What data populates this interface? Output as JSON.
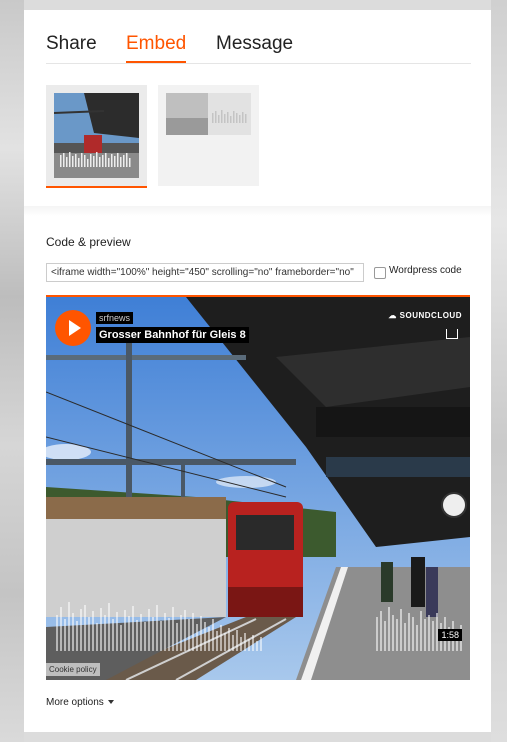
{
  "tabs": [
    {
      "label": "Share"
    },
    {
      "label": "Embed"
    },
    {
      "label": "Message"
    }
  ],
  "embed": {
    "section_title": "Code & preview",
    "code_value": "<iframe width=\"100%\" height=\"450\" scrolling=\"no\" frameborder=\"no\"",
    "wordpress_label": "Wordpress code",
    "more_options_label": "More options"
  },
  "player": {
    "artist": "srfnews",
    "track_title": "Grosser Bahnhof für Gleis 8",
    "brand": "SOUNDCLOUD",
    "duration": "1:58",
    "cookie_policy": "Cookie policy"
  },
  "colors": {
    "accent": "#ff5500"
  }
}
